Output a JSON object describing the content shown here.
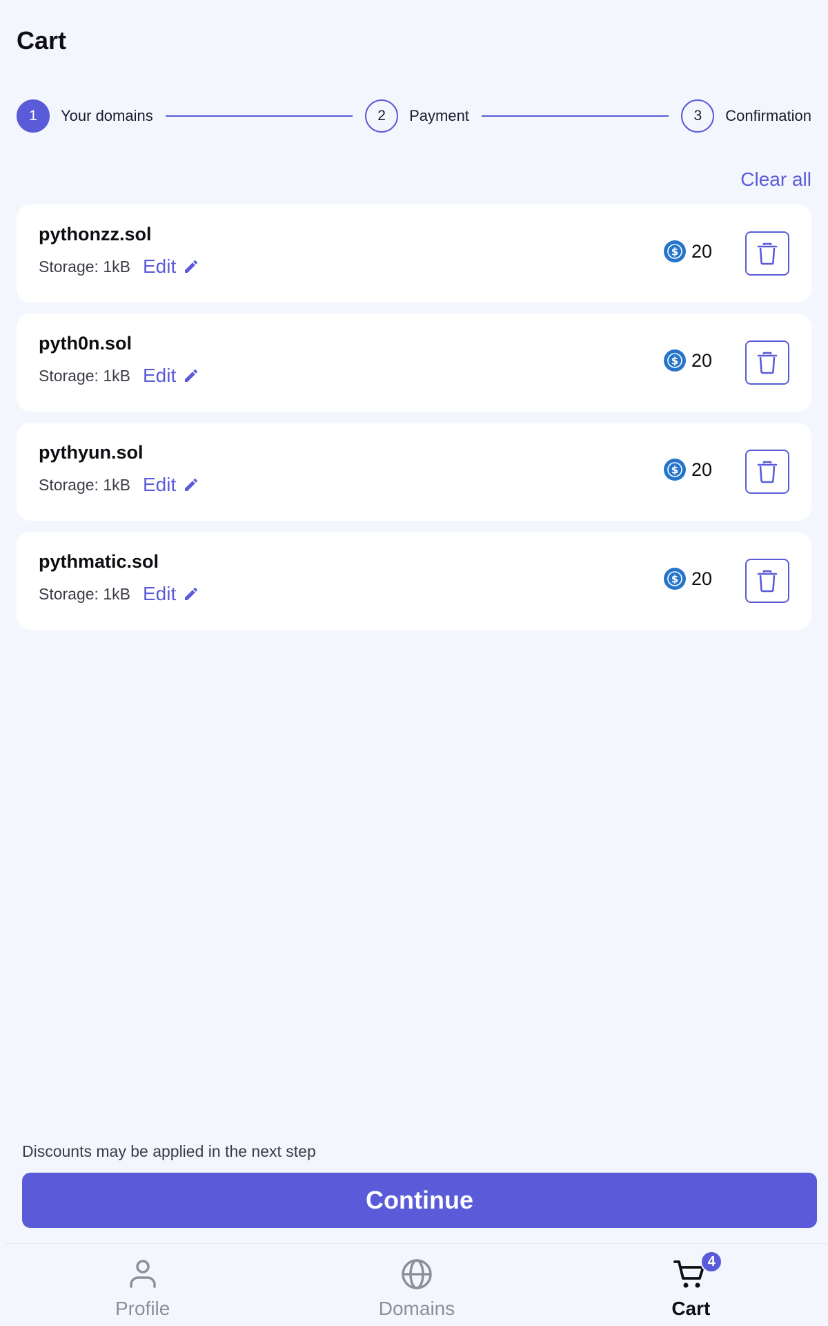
{
  "header": {
    "title": "Cart"
  },
  "stepper": {
    "steps": [
      {
        "number": "1",
        "label": "Your domains",
        "active": true
      },
      {
        "number": "2",
        "label": "Payment",
        "active": false
      },
      {
        "number": "3",
        "label": "Confirmation",
        "active": false
      }
    ]
  },
  "cart": {
    "clear_all_label": "Clear all",
    "items": [
      {
        "name": "pythonzz.sol",
        "storage": "Storage: 1kB",
        "edit_label": "Edit",
        "price": "20"
      },
      {
        "name": "pyth0n.sol",
        "storage": "Storage: 1kB",
        "edit_label": "Edit",
        "price": "20"
      },
      {
        "name": "pythyun.sol",
        "storage": "Storage: 1kB",
        "edit_label": "Edit",
        "price": "20"
      },
      {
        "name": "pythmatic.sol",
        "storage": "Storage: 1kB",
        "edit_label": "Edit",
        "price": "20"
      }
    ]
  },
  "footer": {
    "discount_note": "Discounts may be applied in the next step",
    "continue_label": "Continue"
  },
  "bottom_nav": {
    "items": [
      {
        "label": "Profile",
        "icon": "person-icon",
        "active": false
      },
      {
        "label": "Domains",
        "icon": "globe-icon",
        "active": false
      },
      {
        "label": "Cart",
        "icon": "cart-icon",
        "active": true,
        "badge": "4"
      }
    ]
  },
  "colors": {
    "accent": "#5a5bd8",
    "background": "#f3f6fd",
    "usdc": "#2775ca"
  }
}
